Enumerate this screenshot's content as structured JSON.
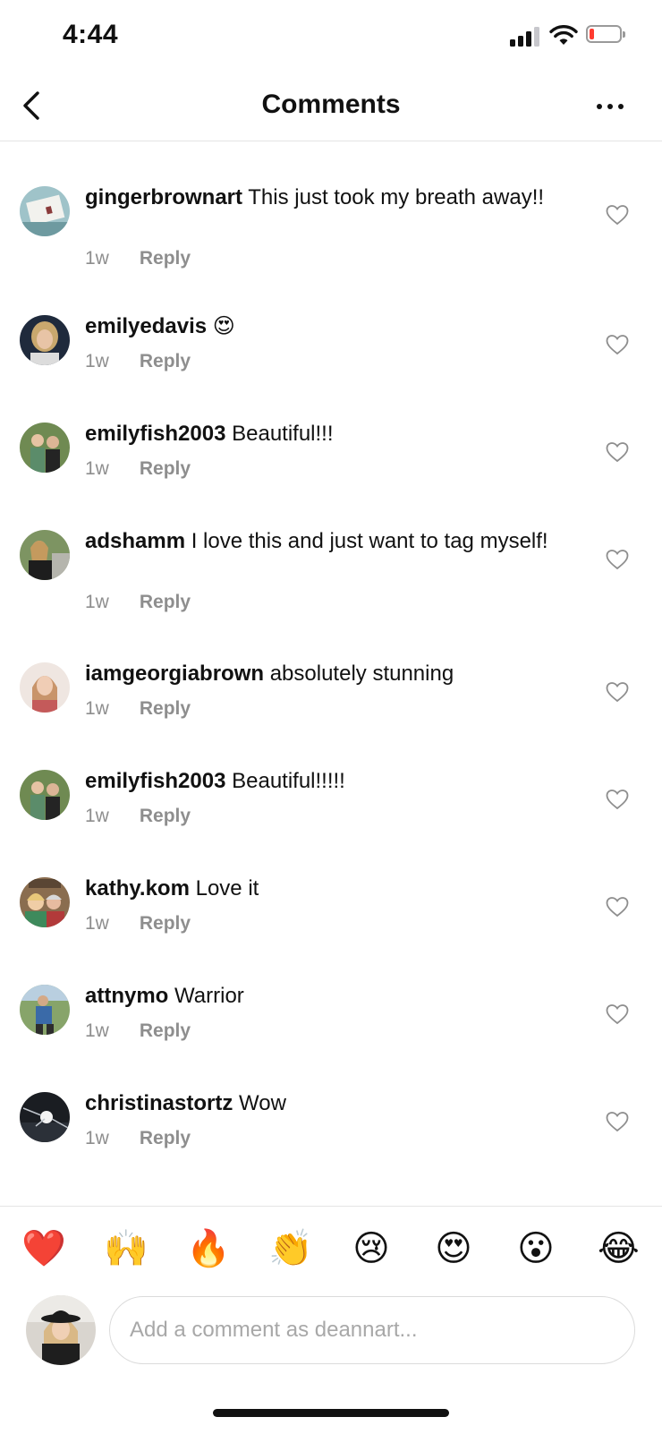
{
  "status_bar": {
    "time": "4:44"
  },
  "header": {
    "title": "Comments"
  },
  "comments": [
    {
      "username": "gingerbrownart",
      "text": "This just took my breath away!!",
      "time": "1w",
      "reply_label": "Reply"
    },
    {
      "username": "emilyedavis",
      "text": "😍",
      "time": "1w",
      "reply_label": "Reply"
    },
    {
      "username": "emilyfish2003",
      "text": "Beautiful!!!",
      "time": "1w",
      "reply_label": "Reply"
    },
    {
      "username": "adshamm",
      "text": "I love this and just want to tag myself!",
      "time": "1w",
      "reply_label": "Reply"
    },
    {
      "username": "iamgeorgiabrown",
      "text": "absolutely stunning",
      "time": "1w",
      "reply_label": "Reply"
    },
    {
      "username": "emilyfish2003",
      "text": "Beautiful!!!!!",
      "time": "1w",
      "reply_label": "Reply"
    },
    {
      "username": "kathy.kom",
      "text": "Love it",
      "time": "1w",
      "reply_label": "Reply"
    },
    {
      "username": "attnymo",
      "text": "Warrior",
      "time": "1w",
      "reply_label": "Reply"
    },
    {
      "username": "christinastortz",
      "text": "Wow",
      "time": "1w",
      "reply_label": "Reply"
    }
  ],
  "emoji_bar": [
    "❤️",
    "🙌",
    "🔥",
    "👏",
    "😢",
    "😍",
    "😮",
    "😂"
  ],
  "compose": {
    "placeholder": "Add a comment as deannart..."
  },
  "colors": {
    "secondary_text": "#8e8e8e",
    "divider": "#e4e4e4",
    "battery_low": "#ff3b30"
  }
}
